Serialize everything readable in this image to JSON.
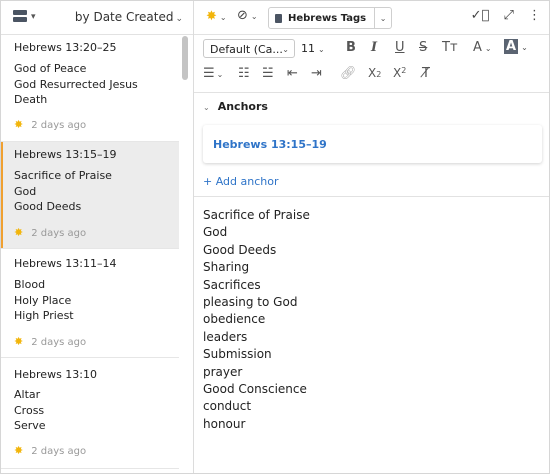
{
  "sidebar": {
    "sort_label": "by Date Created",
    "notes": [
      {
        "title": "Hebrews 13:20–25",
        "tags": [
          "God of Peace",
          "God Resurrected Jesus",
          "Death"
        ],
        "date": "2 days ago",
        "selected": false
      },
      {
        "title": "Hebrews 13:15–19",
        "tags": [
          "Sacrifice of Praise",
          "God",
          "Good Deeds"
        ],
        "date": "2 days ago",
        "selected": true
      },
      {
        "title": "Hebrews 13:11–14",
        "tags": [
          "Blood",
          "Holy Place",
          "High Priest"
        ],
        "date": "2 days ago",
        "selected": false
      },
      {
        "title": "Hebrews 13:10",
        "tags": [
          "Altar",
          "Cross",
          "Serve"
        ],
        "date": "2 days ago",
        "selected": false
      }
    ]
  },
  "header": {
    "tag_button_label": "Hebrews Tags",
    "star_color": "#f2b50b"
  },
  "toolbar": {
    "font_family_value": "Default (Ca...",
    "font_size_value": "11"
  },
  "anchors": {
    "heading": "Anchors",
    "items": [
      "Hebrews 13:15–19"
    ],
    "add_label": "+ Add anchor",
    "link_color": "#2f74c8"
  },
  "editor": {
    "lines": [
      "Sacrifice of Praise",
      "God",
      "Good Deeds",
      "Sharing",
      "Sacrifices",
      "pleasing to God",
      "obedience",
      "leaders",
      "Submission",
      "prayer",
      "Good Conscience",
      "conduct",
      "honour"
    ]
  }
}
